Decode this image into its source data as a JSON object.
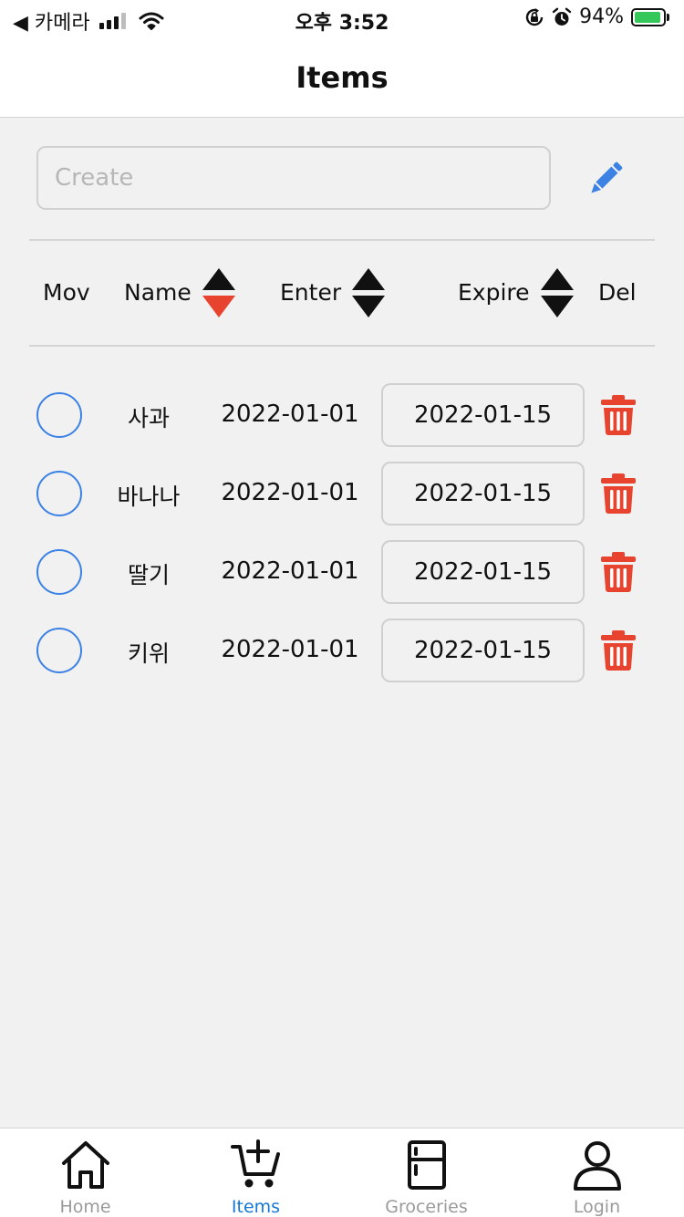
{
  "status_bar": {
    "back_label": "◀ 카메라",
    "time": "오후 3:52",
    "battery_percent": "94%",
    "battery_level": 0.94,
    "icons": [
      "cellular-signal-icon",
      "wifi-icon",
      "orientation-lock-icon",
      "alarm-icon",
      "battery-charging-icon"
    ]
  },
  "nav": {
    "title": "Items"
  },
  "create": {
    "placeholder": "Create",
    "value": "",
    "edit_icon": "pencil-icon"
  },
  "header": {
    "mov": "Mov",
    "name": "Name",
    "enter": "Enter",
    "expire": "Expire",
    "del": "Del",
    "active_sort": "name-descending"
  },
  "items": [
    {
      "name": "사과",
      "enter": "2022-01-01",
      "expire": "2022-01-15",
      "selected": false
    },
    {
      "name": "바나나",
      "enter": "2022-01-01",
      "expire": "2022-01-15",
      "selected": false
    },
    {
      "name": "딸기",
      "enter": "2022-01-01",
      "expire": "2022-01-15",
      "selected": false
    },
    {
      "name": "키위",
      "enter": "2022-01-01",
      "expire": "2022-01-15",
      "selected": false
    }
  ],
  "tabs": [
    {
      "label": "Home",
      "icon": "home-icon",
      "active": false
    },
    {
      "label": "Items",
      "icon": "cart-plus-icon",
      "active": true
    },
    {
      "label": "Groceries",
      "icon": "fridge-icon",
      "active": false
    },
    {
      "label": "Login",
      "icon": "user-icon",
      "active": false
    }
  ],
  "colors": {
    "accent_blue": "#3c82e4",
    "tab_active": "#1479d6",
    "delete_red": "#e8432e",
    "sort_active_red": "#e8432e",
    "background": "#f1f1f1"
  }
}
